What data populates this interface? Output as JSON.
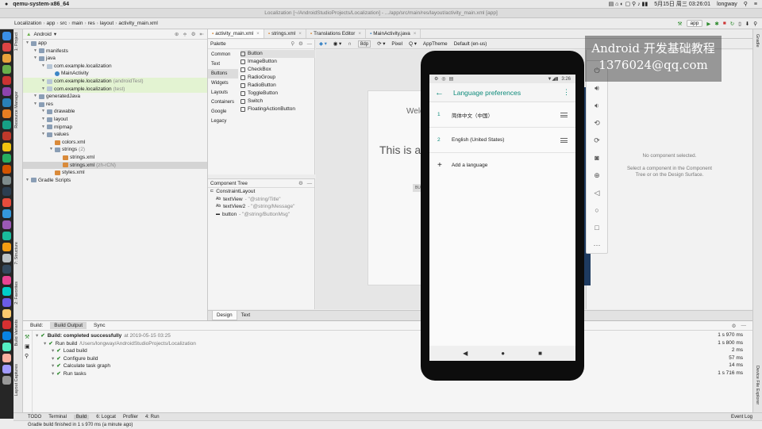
{
  "menubar": {
    "app": "qemu-system-x86_64",
    "date": "5月15日 周三 03:26:01",
    "user": "longway"
  },
  "window_title": "Localization [~/AndroidStudioProjects/Localization] - .../app/src/main/res/layout/activity_main.xml [app]",
  "toolbar": {
    "breadcrumbs": [
      "Localization",
      "app",
      "src",
      "main",
      "res",
      "layout",
      "activity_main.xml"
    ],
    "run_config": "app"
  },
  "project": {
    "view": "Android",
    "tree": [
      {
        "label": "app",
        "depth": 0,
        "type": "folder"
      },
      {
        "label": "manifests",
        "depth": 1,
        "type": "folder"
      },
      {
        "label": "java",
        "depth": 1,
        "type": "folder"
      },
      {
        "label": "com.example.localization",
        "depth": 2,
        "type": "pkg"
      },
      {
        "label": "MainActivity",
        "depth": 3,
        "type": "cls"
      },
      {
        "label": "com.example.localization",
        "suffix": "(androidTest)",
        "depth": 2,
        "type": "pkg",
        "hl": true
      },
      {
        "label": "com.example.localization",
        "suffix": "(test)",
        "depth": 2,
        "type": "pkg",
        "hl": true
      },
      {
        "label": "generatedJava",
        "depth": 1,
        "type": "folder"
      },
      {
        "label": "res",
        "depth": 1,
        "type": "folder"
      },
      {
        "label": "drawable",
        "depth": 2,
        "type": "folder"
      },
      {
        "label": "layout",
        "depth": 2,
        "type": "folder"
      },
      {
        "label": "mipmap",
        "depth": 2,
        "type": "folder"
      },
      {
        "label": "values",
        "depth": 2,
        "type": "folder"
      },
      {
        "label": "colors.xml",
        "depth": 3,
        "type": "xml"
      },
      {
        "label": "strings",
        "suffix": "(2)",
        "depth": 3,
        "type": "folder"
      },
      {
        "label": "strings.xml",
        "depth": 4,
        "type": "xml"
      },
      {
        "label": "strings.xml",
        "suffix": "(zh-rCN)",
        "depth": 4,
        "type": "xml",
        "sel": true
      },
      {
        "label": "styles.xml",
        "depth": 3,
        "type": "xml"
      },
      {
        "label": "Gradle Scripts",
        "depth": 0,
        "type": "folder"
      }
    ]
  },
  "editor_tabs": [
    "activity_main.xml",
    "strings.xml",
    "Translations Editor",
    "MainActivity.java"
  ],
  "palette": {
    "title": "Palette",
    "categories": [
      "Common",
      "Text",
      "Buttons",
      "Widgets",
      "Layouts",
      "Containers",
      "Google",
      "Legacy"
    ],
    "items": [
      "Button",
      "ImageButton",
      "CheckBox",
      "RadioGroup",
      "RadioButton",
      "ToggleButton",
      "Switch",
      "FloatingActionButton"
    ]
  },
  "component_tree": {
    "title": "Component Tree",
    "rows": [
      {
        "name": "ConstraintLayout",
        "value": ""
      },
      {
        "name": "textView",
        "value": "- \"@string/Title\""
      },
      {
        "name": "textView2",
        "value": "- \"@string/Message\""
      },
      {
        "name": "button",
        "value": "- \"@string/ButtonMsg\""
      }
    ]
  },
  "design_toolbar": {
    "density": "8dp",
    "device": "Pixel",
    "theme": "AppTheme",
    "locale": "Default (en-us)"
  },
  "blueprint": {
    "line1": "Welco",
    "line2": "This is a",
    "btn": "BUTT"
  },
  "attributes": {
    "empty_title": "No component selected.",
    "empty_hint": "Select a component in the Component Tree or on the Design Surface."
  },
  "design_text_tabs": [
    "Design",
    "Text"
  ],
  "build": {
    "tabs": [
      "Build:",
      "Build Output",
      "Sync"
    ],
    "rows": [
      {
        "text": "Build: completed successfully",
        "extra": "at 2019-05-15 03:25",
        "time": "1 s 970 ms",
        "depth": 0
      },
      {
        "text": "Run build",
        "extra": "/Users/longway/AndroidStudioProjects/Localization",
        "time": "1 s 800 ms",
        "depth": 1
      },
      {
        "text": "Load build",
        "extra": "",
        "time": "2 ms",
        "depth": 2
      },
      {
        "text": "Configure build",
        "extra": "",
        "time": "57 ms",
        "depth": 2
      },
      {
        "text": "Calculate task graph",
        "extra": "",
        "time": "14 ms",
        "depth": 2
      },
      {
        "text": "Run tasks",
        "extra": "",
        "time": "1 s 716 ms",
        "depth": 2
      }
    ]
  },
  "bottom_tools": [
    "TODO",
    "Terminal",
    "Build",
    "6: Logcat",
    "Profiler",
    "4: Run"
  ],
  "event_log": "Event Log",
  "status": "Gradle build finished in 1 s 970 ms (a minute ago)",
  "watermark": {
    "line1": "Android 开发基础教程",
    "line2": "1376024@qq.com"
  },
  "left_strip_tabs": [
    "1: Project",
    "Resource Manager",
    "7: Structure",
    "2: Favorites",
    "Build Variants",
    "Layout Captures"
  ],
  "right_strip_tabs": [
    "Gradle",
    "Device File Explorer"
  ],
  "phone": {
    "time": "3:26",
    "title": "Language preferences",
    "languages": [
      {
        "num": "1",
        "name": "简体中文（中国）"
      },
      {
        "num": "2",
        "name": "English (United States)"
      }
    ],
    "add": "Add a language"
  },
  "colors": {
    "accent": "#0d8a7a",
    "highlight": "#e3f3d2",
    "dock": "#262626"
  }
}
